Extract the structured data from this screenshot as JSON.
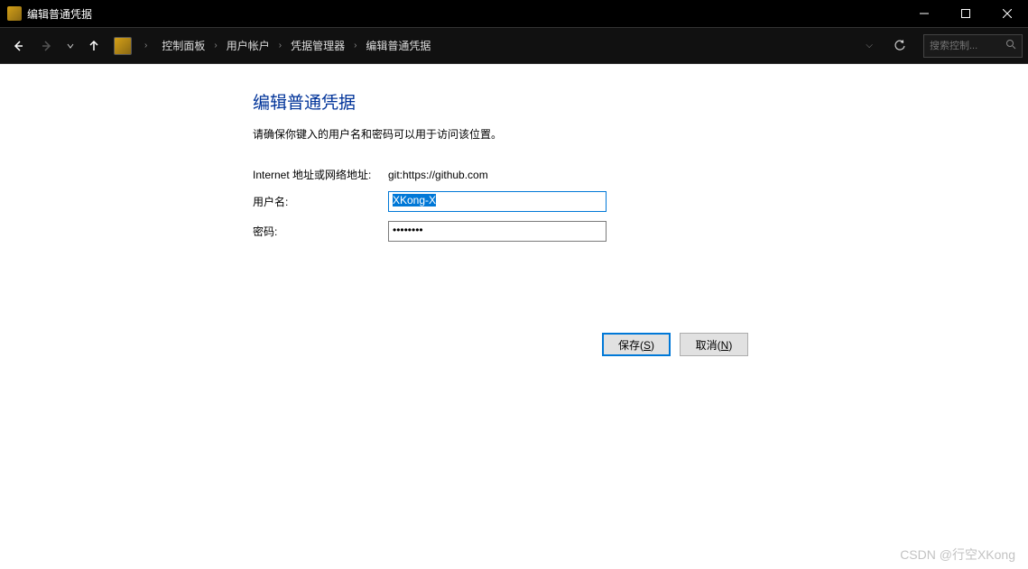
{
  "titlebar": {
    "title": "编辑普通凭据"
  },
  "breadcrumb": {
    "items": [
      "控制面板",
      "用户帐户",
      "凭据管理器",
      "编辑普通凭据"
    ]
  },
  "search": {
    "placeholder": "搜索控制..."
  },
  "page": {
    "title": "编辑普通凭据",
    "description": "请确保你键入的用户名和密码可以用于访问该位置。"
  },
  "form": {
    "address_label": "Internet 地址或网络地址:",
    "address_value": "git:https://github.com",
    "username_label": "用户名:",
    "username_value": "XKong-X",
    "password_label": "密码:",
    "password_value": "••••••••"
  },
  "buttons": {
    "save": "保存",
    "save_key": "S",
    "cancel": "取消",
    "cancel_key": "N"
  },
  "watermark": "CSDN @行空XKong"
}
